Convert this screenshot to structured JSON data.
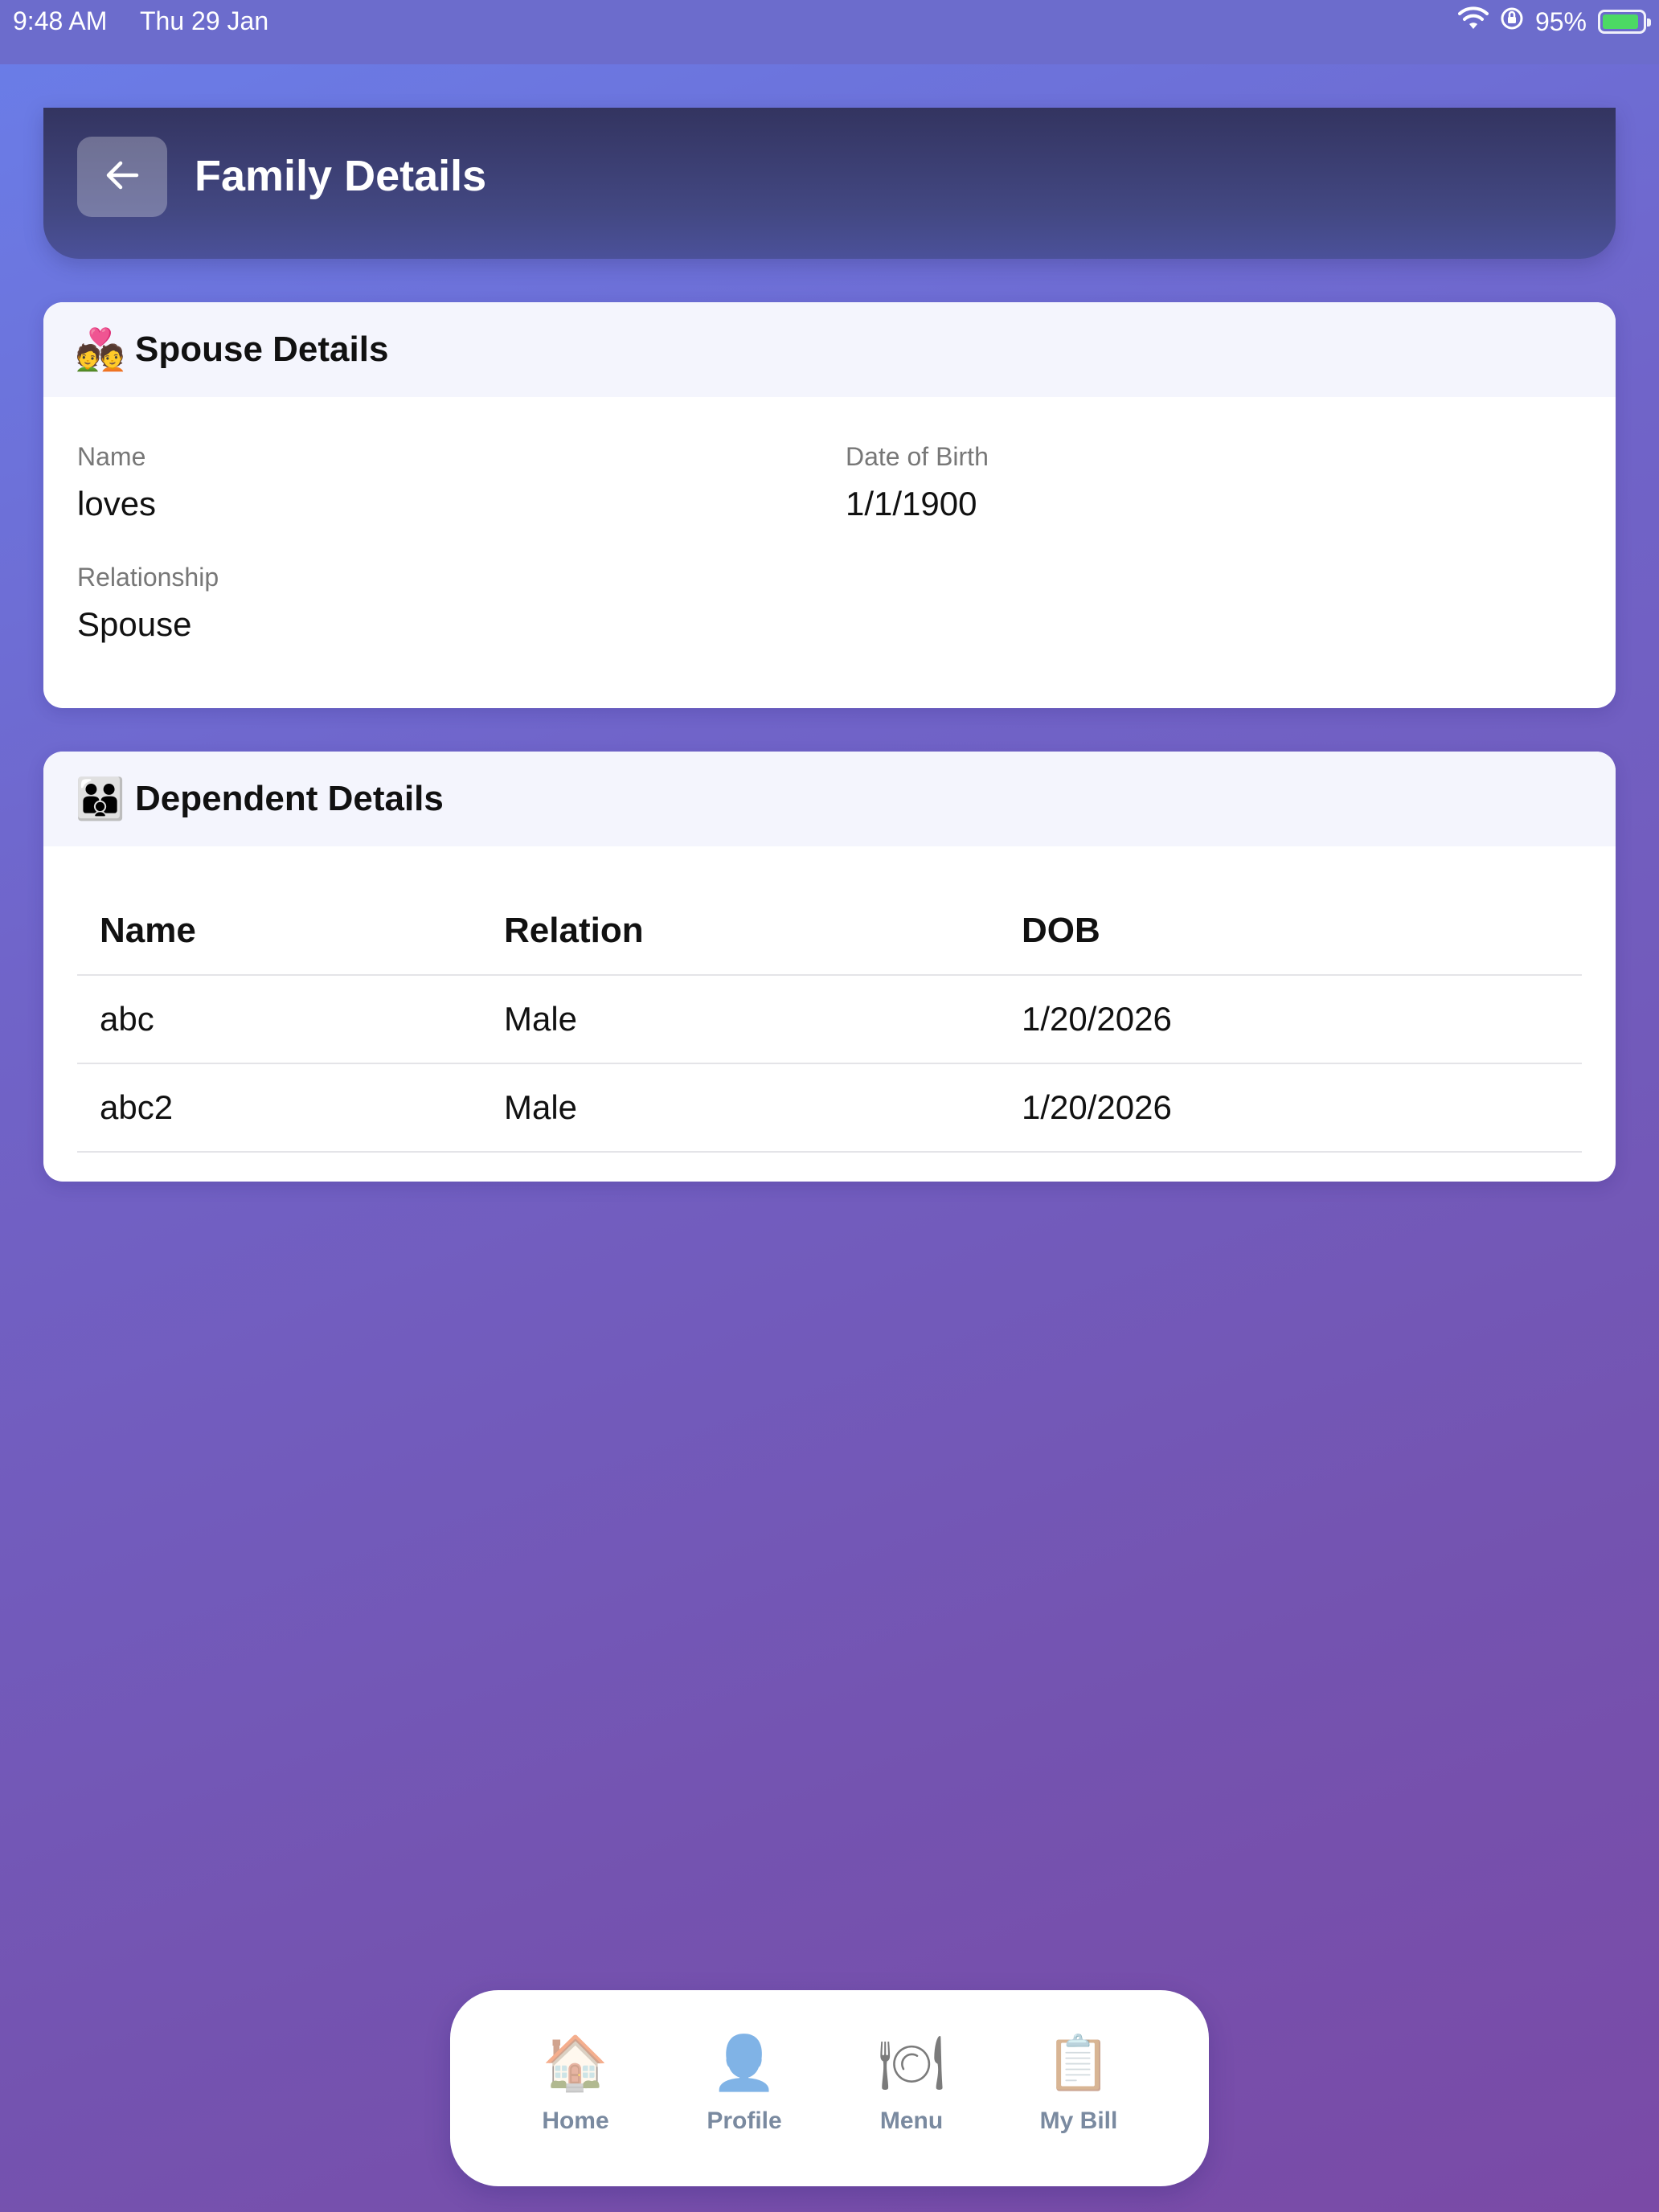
{
  "status_bar": {
    "time": "9:48 AM",
    "date": "Thu 29 Jan",
    "battery": "95%",
    "icons": [
      "wifi-icon",
      "rotation-lock-icon",
      "battery-charging-icon"
    ]
  },
  "header": {
    "title": "Family Details",
    "back_icon": "arrow-left-icon"
  },
  "spouse": {
    "icon": "💑",
    "title": "Spouse Details",
    "name_label": "Name",
    "name_value": "loves",
    "dob_label": "Date of Birth",
    "dob_value": "1/1/1900",
    "relationship_label": "Relationship",
    "relationship_value": "Spouse"
  },
  "dependent": {
    "icon": "👪",
    "title": "Dependent Details",
    "columns": [
      "Name",
      "Relation",
      "DOB"
    ],
    "rows": [
      [
        "abc",
        "Male",
        "1/20/2026"
      ],
      [
        "abc2",
        "Male",
        "1/20/2026"
      ]
    ]
  },
  "nav": {
    "items": [
      {
        "label": "Home",
        "icon": "🏠"
      },
      {
        "label": "Profile",
        "icon": "👤"
      },
      {
        "label": "Menu",
        "icon": "🍽"
      },
      {
        "label": "My Bill",
        "icon": "📋"
      }
    ]
  },
  "colors": {
    "accent": "#434883",
    "background_start": "#6a7ee9",
    "background_end": "#7a4aa6"
  }
}
